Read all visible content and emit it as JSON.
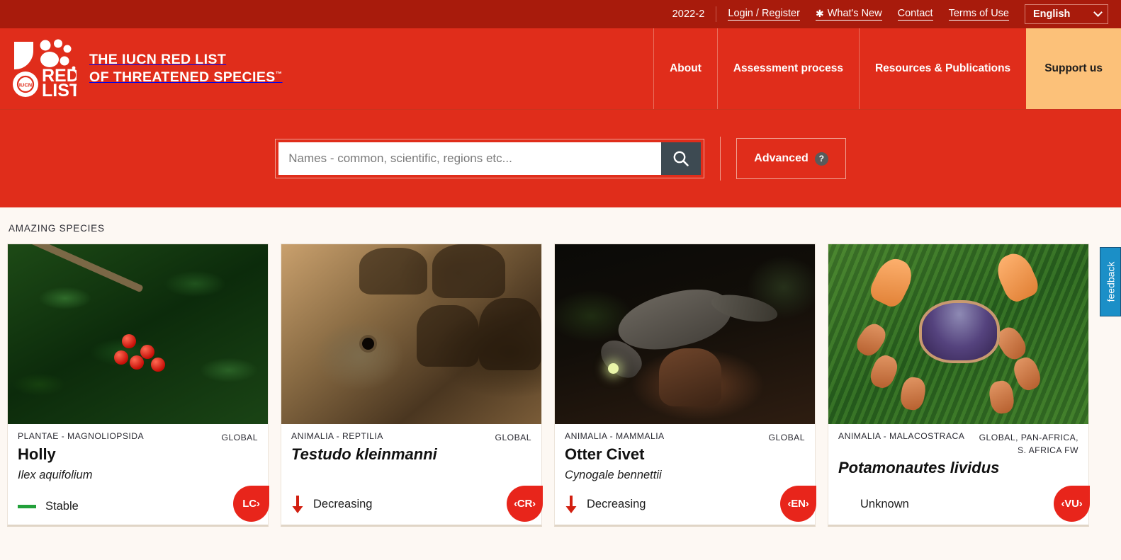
{
  "topbar": {
    "version": "2022-2",
    "links": [
      {
        "label": "Login / Register",
        "icon": ""
      },
      {
        "label": "What's New",
        "icon": "sparkle-icon"
      },
      {
        "label": "Contact",
        "icon": ""
      },
      {
        "label": "Terms of Use",
        "icon": ""
      }
    ],
    "language": "English"
  },
  "header": {
    "brand_line1": "THE IUCN RED LIST",
    "brand_line2": "OF THREATENED SPECIES",
    "brand_tm": "™",
    "logo_text_line1": "RED",
    "logo_text_line2": "LIST",
    "logo_iucn": "IUCN",
    "nav": [
      {
        "label": "About",
        "highlight": false
      },
      {
        "label": "Assessment process",
        "highlight": false
      },
      {
        "label": "Resources & Publications",
        "highlight": false
      },
      {
        "label": "Support us",
        "highlight": true
      }
    ]
  },
  "search": {
    "placeholder": "Names - common, scientific, regions etc...",
    "value": "",
    "button_icon": "search-icon",
    "advanced_label": "Advanced",
    "help_icon": "?"
  },
  "main": {
    "section_label": "AMAZING SPECIES",
    "cards": [
      {
        "taxon": "PLANTAE - MAGNOLIOPSIDA",
        "region": "GLOBAL",
        "common_name": "Holly",
        "scientific_name": "Ilex aquifolium",
        "trend": "Stable",
        "trend_icon": "stable-dash-icon",
        "status_code": "LC",
        "status_display": "LC›",
        "status_color": "#e8251b",
        "photo": "holly"
      },
      {
        "taxon": "ANIMALIA - REPTILIA",
        "region": "GLOBAL",
        "common_name": "Testudo kleinmanni",
        "scientific_name": "",
        "trend": "Decreasing",
        "trend_icon": "arrow-down-icon",
        "status_code": "CR",
        "status_display": "‹CR›",
        "status_color": "#e8251b",
        "photo": "tortoise"
      },
      {
        "taxon": "ANIMALIA - MAMMALIA",
        "region": "GLOBAL",
        "common_name": "Otter Civet",
        "scientific_name": "Cynogale bennettii",
        "trend": "Decreasing",
        "trend_icon": "arrow-down-icon",
        "status_code": "EN",
        "status_display": "‹EN›",
        "status_color": "#e8251b",
        "photo": "civet"
      },
      {
        "taxon": "ANIMALIA - MALACOSTRACA",
        "region": "GLOBAL, PAN-AFRICA, S. AFRICA FW",
        "common_name": "Potamonautes lividus",
        "scientific_name": "",
        "trend": "Unknown",
        "trend_icon": "none",
        "status_code": "VU",
        "status_display": "‹VU›",
        "status_color": "#e8251b",
        "photo": "crab"
      }
    ]
  },
  "feedback": {
    "label": "feedback",
    "color": "#1b8fc7"
  },
  "colors": {
    "topbar_red": "#a81b0c",
    "header_red": "#e02d1b",
    "support_orange": "#fcc179",
    "page_bg": "#fdf8f3",
    "search_btn": "#3d4a52",
    "stable_green": "#22a03a",
    "decreasing_red": "#d21f10"
  }
}
